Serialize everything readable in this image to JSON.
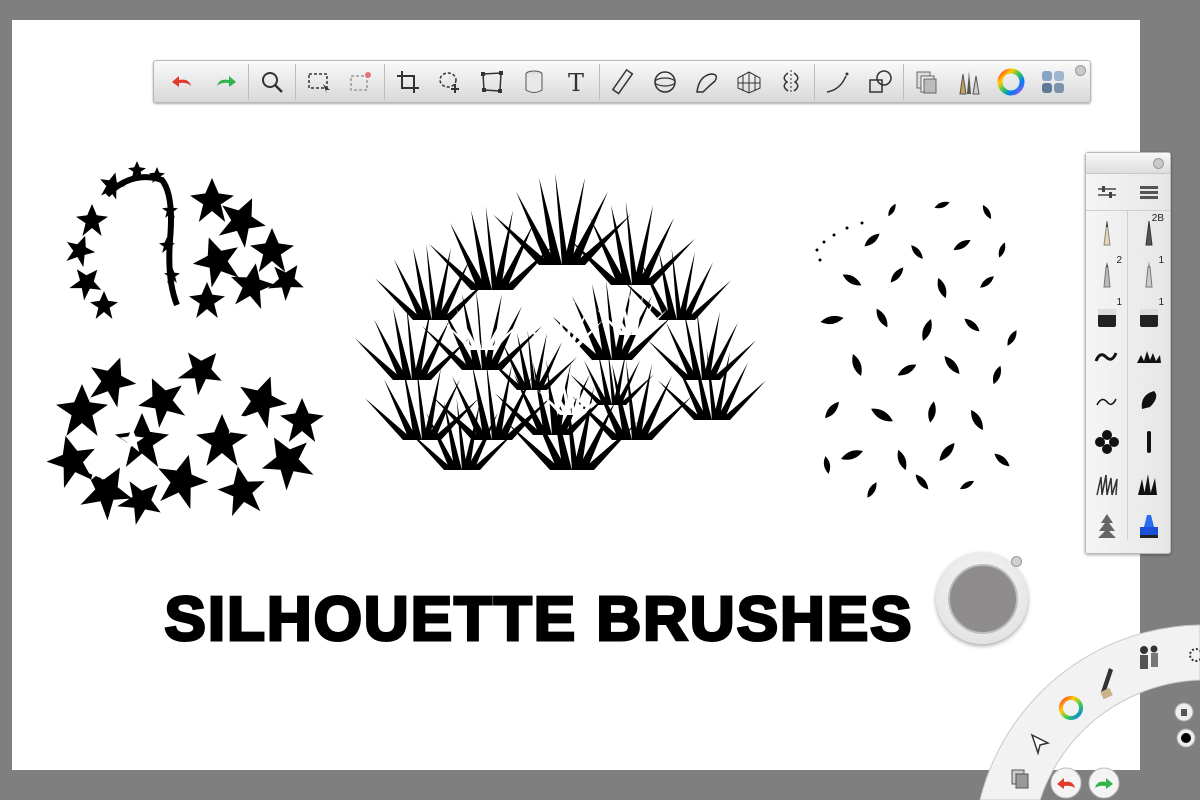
{
  "canvas": {
    "title_text": "SILHOUETTE BRUSHES",
    "background": "#ffffff"
  },
  "colors": {
    "workspace": "#7f7f7f",
    "undo_red": "#e23a2a",
    "redo_green": "#2fb34a",
    "puck_color": "#8e8c8c"
  },
  "toolbar": {
    "tools": [
      {
        "id": "undo",
        "icon": "undo-arrow-icon"
      },
      {
        "id": "redo",
        "icon": "redo-arrow-icon"
      },
      {
        "id": "zoom",
        "icon": "magnifier-icon"
      },
      {
        "id": "select",
        "icon": "rect-select-icon"
      },
      {
        "id": "deselect",
        "icon": "deselect-icon"
      },
      {
        "id": "crop",
        "icon": "crop-icon"
      },
      {
        "id": "transform",
        "icon": "lasso-move-icon"
      },
      {
        "id": "distort",
        "icon": "distort-icon"
      },
      {
        "id": "fill",
        "icon": "paint-bucket-icon"
      },
      {
        "id": "text",
        "icon": "text-icon",
        "label": "T"
      },
      {
        "id": "ruler",
        "icon": "ruler-icon"
      },
      {
        "id": "ellipse",
        "icon": "ellipse-guide-icon"
      },
      {
        "id": "curve",
        "icon": "french-curve-icon"
      },
      {
        "id": "perspective",
        "icon": "perspective-grid-icon"
      },
      {
        "id": "symmetry",
        "icon": "symmetry-icon"
      },
      {
        "id": "stroke",
        "icon": "stroke-icon"
      },
      {
        "id": "shapes",
        "icon": "shapes-icon"
      },
      {
        "id": "layers",
        "icon": "layers-icon"
      },
      {
        "id": "brushes",
        "icon": "brush-library-icon"
      },
      {
        "id": "color",
        "icon": "color-wheel-icon"
      },
      {
        "id": "copic",
        "icon": "copic-palette-icon"
      }
    ]
  },
  "brush_panel": {
    "badges": [
      "2B",
      "2",
      "1",
      "1",
      "1"
    ],
    "brushes": [
      {
        "name": "pencil-brush-icon",
        "badge": ""
      },
      {
        "name": "pencil-2b-brush-icon",
        "badge": "2B"
      },
      {
        "name": "ballpoint-brush-icon",
        "badge": "2"
      },
      {
        "name": "fineliner-brush-icon",
        "badge": "1"
      },
      {
        "name": "marker-brush-icon",
        "badge": "1"
      },
      {
        "name": "chisel-marker-brush-icon",
        "badge": "1"
      },
      {
        "name": "squiggle-brush-icon",
        "badge": ""
      },
      {
        "name": "spatter-brush-icon",
        "badge": ""
      },
      {
        "name": "stroke-brush-icon",
        "badge": ""
      },
      {
        "name": "blob-brush-icon",
        "badge": ""
      },
      {
        "name": "flower-brush-icon",
        "badge": ""
      },
      {
        "name": "bar-brush-icon",
        "badge": ""
      },
      {
        "name": "grass-brush-icon",
        "badge": ""
      },
      {
        "name": "grass-dark-brush-icon",
        "badge": ""
      },
      {
        "name": "pine-brush-icon",
        "badge": ""
      },
      {
        "name": "blue-marker-brush-icon",
        "badge": ""
      }
    ]
  },
  "lagoon": {
    "items": [
      "brush-icon",
      "people-icon",
      "color-wheel-icon",
      "select-arrow-icon",
      "layers-icon",
      "undo-icon",
      "redo-icon",
      "settings-icon",
      "trash-icon",
      "black-dot-icon"
    ]
  }
}
